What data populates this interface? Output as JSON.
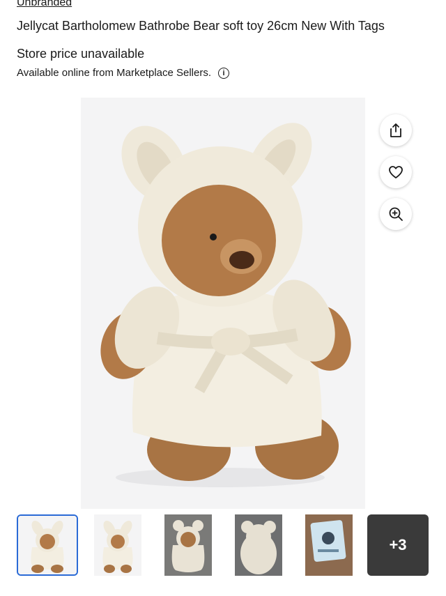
{
  "product": {
    "brand": "Unbranded",
    "title": "Jellycat Bartholomew Bathrobe Bear soft toy 26cm New With Tags",
    "store_price": "Store price unavailable",
    "availability": "Available online from Marketplace Sellers."
  },
  "actions": {
    "share_icon": "share-icon",
    "favourite_icon": "heart-icon",
    "zoom_icon": "zoom-in-icon"
  },
  "gallery": {
    "selected_index": 0,
    "more_count_label": "+3"
  },
  "colors": {
    "selected_border": "#2a6ad6",
    "robe": "#f3eee1",
    "fur": "#b27a48"
  }
}
